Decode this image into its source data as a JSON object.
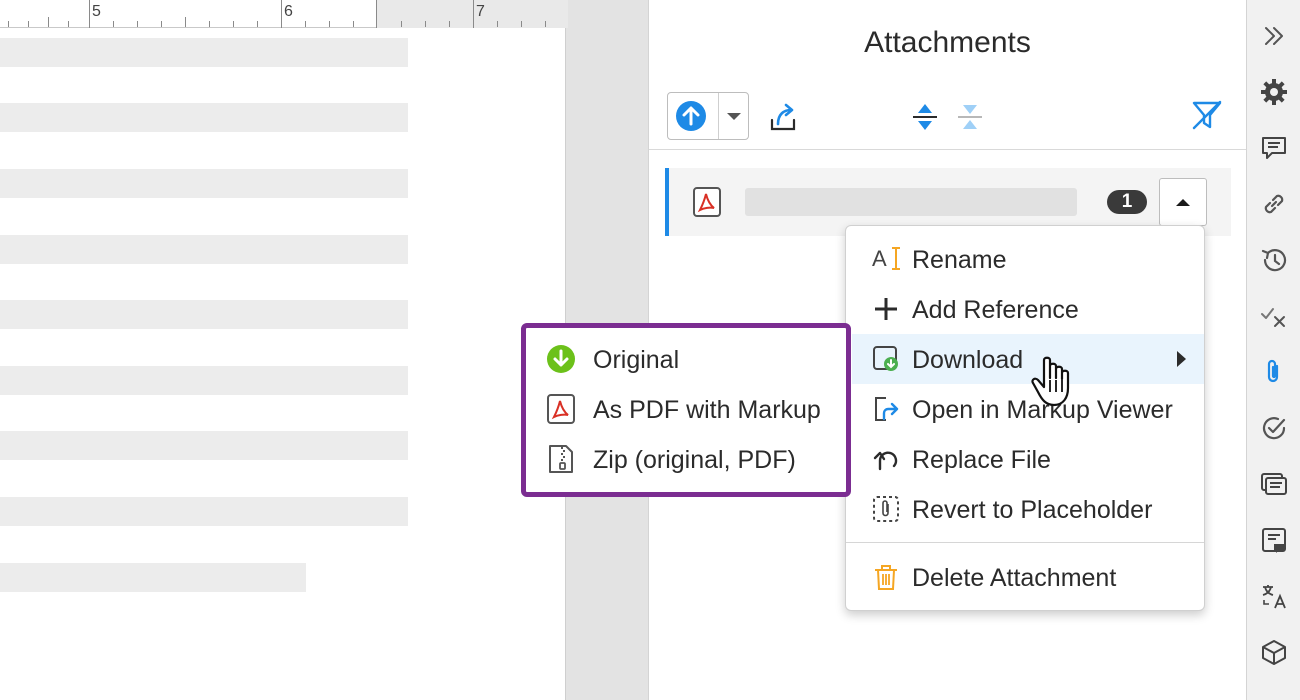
{
  "ruler": {
    "labels": [
      "5",
      "6",
      "7"
    ]
  },
  "panel": {
    "title": "Attachments",
    "toolbar": {
      "upload_icon": "upload-circle-icon",
      "dropdown_icon": "caret-down-icon",
      "share_icon": "share-export-icon",
      "expand_icon": "expand-all-icon",
      "collapse_icon": "collapse-all-icon",
      "filter_icon": "filter-off-icon"
    },
    "attachment": {
      "file_icon": "pdf-file-icon",
      "count": "1",
      "toggle_icon": "caret-up-icon"
    }
  },
  "menu": {
    "items": [
      {
        "label": "Rename",
        "icon": "rename-icon"
      },
      {
        "label": "Add Reference",
        "icon": "plus-icon"
      },
      {
        "label": "Download",
        "icon": "download-icon",
        "has_submenu": true,
        "highlighted": true
      },
      {
        "label": "Open in Markup Viewer",
        "icon": "open-external-icon"
      },
      {
        "label": "Replace File",
        "icon": "replace-undo-icon"
      },
      {
        "label": "Revert to Placeholder",
        "icon": "placeholder-icon"
      },
      {
        "label": "Delete Attachment",
        "icon": "trash-icon"
      }
    ]
  },
  "submenu": {
    "items": [
      {
        "label": "Original",
        "icon": "download-circle-icon"
      },
      {
        "label": "As PDF with Markup",
        "icon": "pdf-file-icon"
      },
      {
        "label": "Zip (original, PDF)",
        "icon": "zip-file-icon"
      }
    ]
  },
  "sidebar": {
    "icons": [
      "collapse-panel-icon",
      "gear-icon",
      "comment-icon",
      "link-icon",
      "history-icon",
      "check-cross-icon",
      "paperclip-icon",
      "check-circle-icon",
      "comments-list-icon",
      "note-icon",
      "translate-icon",
      "cube-icon"
    ]
  },
  "colors": {
    "accent_blue": "#1e8ae6",
    "highlight_purple": "#7b2d91",
    "pdf_red": "#d93025",
    "download_green": "#4caf50",
    "delete_orange": "#f5a623"
  }
}
